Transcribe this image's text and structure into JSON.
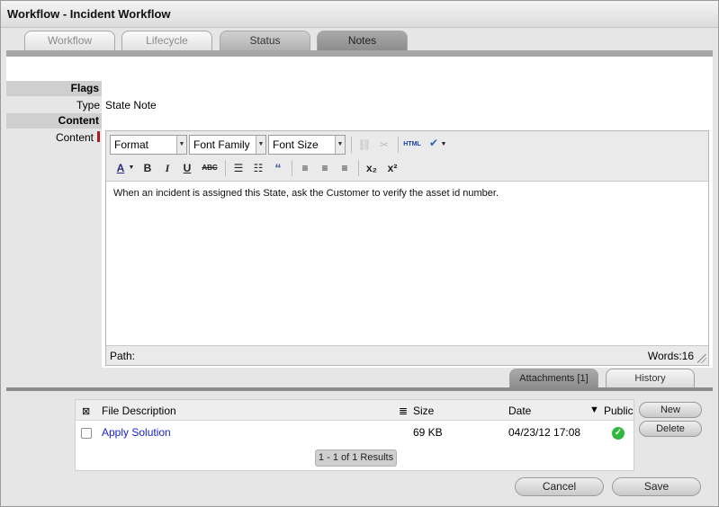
{
  "window": {
    "title": "Workflow - Incident Workflow"
  },
  "tabs": [
    {
      "label": "Workflow"
    },
    {
      "label": "Lifecycle"
    },
    {
      "label": "Status"
    },
    {
      "label": "Notes"
    }
  ],
  "form": {
    "flags_heading": "Flags",
    "type_label": "Type",
    "type_value": "State Note",
    "content_heading": "Content",
    "content_label": "Content"
  },
  "editor": {
    "format_select": "Format",
    "font_family_select": "Font Family",
    "font_size_select": "Font Size",
    "html_button": "HTML",
    "body_text": "When an incident is assigned this State, ask the Customer to verify the asset id number.",
    "path_label": "Path:",
    "word_count": "Words:16"
  },
  "lower_tabs": {
    "attachments": "Attachments [1]",
    "history": "History"
  },
  "attachments": {
    "columns": {
      "description": "File Description",
      "size": "Size",
      "date": "Date",
      "public": "Public"
    },
    "rows": [
      {
        "description": "Apply Solution",
        "size": "69 KB",
        "date": "04/23/12 17:08",
        "public": true
      }
    ],
    "paging": "1 - 1 of 1 Results",
    "new_button": "New",
    "delete_button": "Delete"
  },
  "footer": {
    "cancel_button": "Cancel",
    "save_button": "Save"
  }
}
